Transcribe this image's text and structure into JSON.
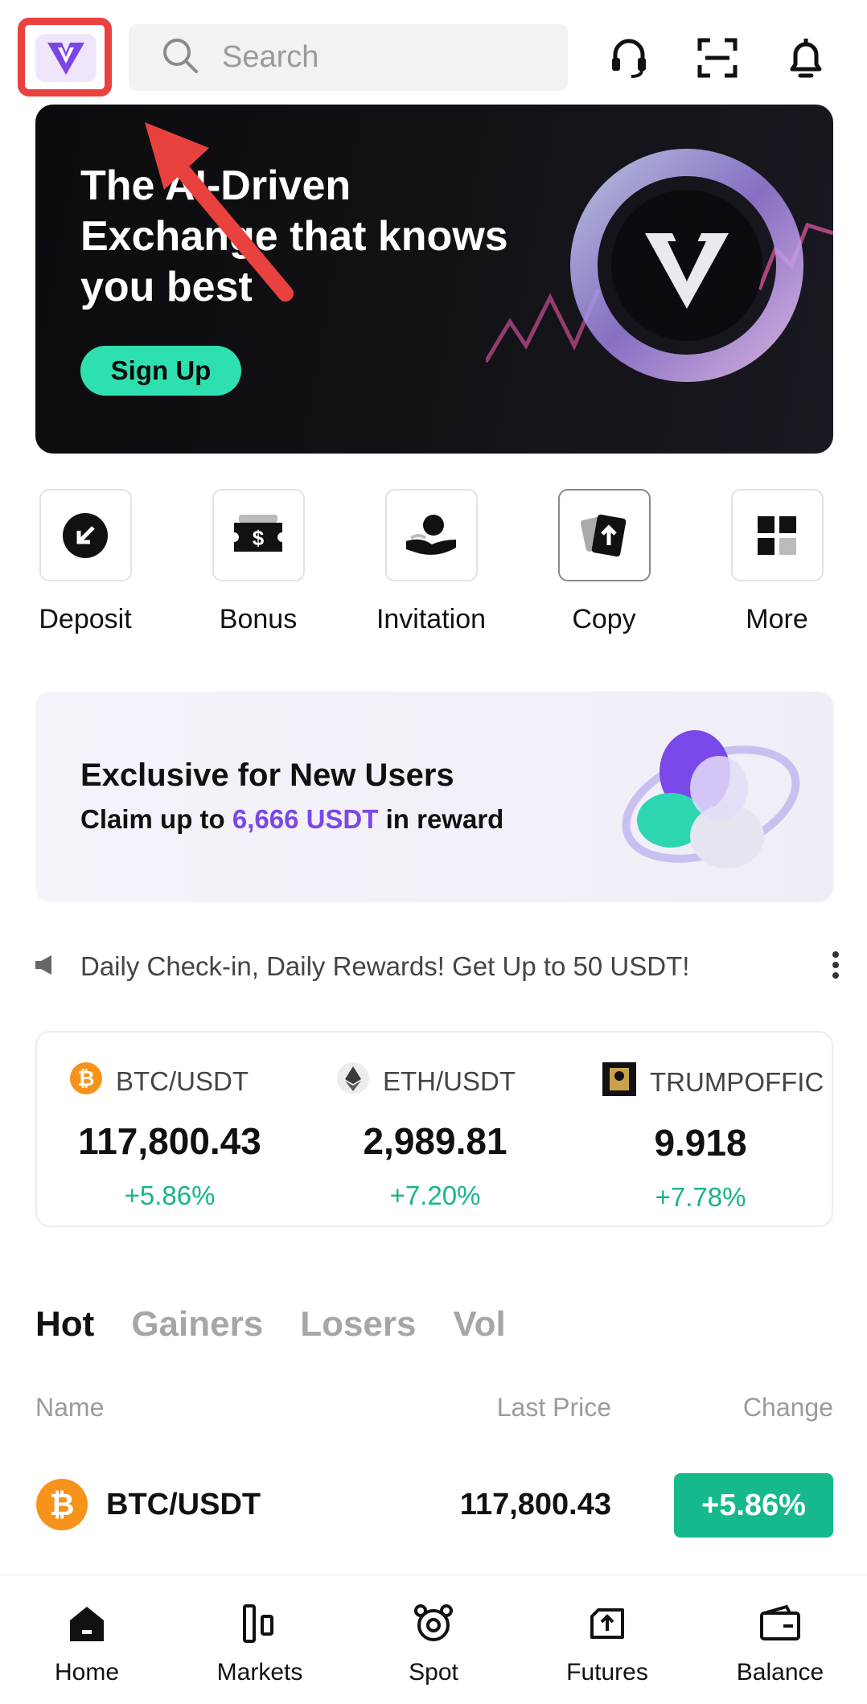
{
  "header": {
    "search_placeholder": "Search",
    "icons": [
      "support-headset-icon",
      "scan-icon",
      "bell-icon"
    ]
  },
  "banner": {
    "title_line1": "The AI-Driven",
    "title_line2": "Exchange that knows",
    "title_line3": "you best",
    "button_label": "Sign Up"
  },
  "actions": [
    {
      "label": "Deposit",
      "icon": "deposit-arrow-icon"
    },
    {
      "label": "Bonus",
      "icon": "ticket-dollar-icon"
    },
    {
      "label": "Invitation",
      "icon": "invitation-person-icon"
    },
    {
      "label": "Copy",
      "icon": "copy-card-icon"
    },
    {
      "label": "More",
      "icon": "grid-icon"
    }
  ],
  "promo": {
    "title": "Exclusive for New Users",
    "sub_prefix": "Claim up to ",
    "sub_amount": "6,666 USDT",
    "sub_suffix": " in reward"
  },
  "announcement": {
    "text": "Daily Check-in, Daily Rewards! Get Up to 50 USDT!"
  },
  "ticker": [
    {
      "pair": "BTC/USDT",
      "price": "117,800.43",
      "change": "+5.86%"
    },
    {
      "pair": "ETH/USDT",
      "price": "2,989.81",
      "change": "+7.20%"
    },
    {
      "pair": "TRUMPOFFIC",
      "price": "9.918",
      "change": "+7.78%"
    }
  ],
  "tabs": [
    "Hot",
    "Gainers",
    "Losers",
    "Vol"
  ],
  "table": {
    "col_name": "Name",
    "col_price": "Last Price",
    "col_change": "Change",
    "rows": [
      {
        "pair": "BTC/USDT",
        "price": "117,800.43",
        "change": "+5.86%"
      }
    ]
  },
  "bottom_nav": [
    "Home",
    "Markets",
    "Spot",
    "Futures",
    "Balance"
  ],
  "colors": {
    "accent_green": "#16b98c",
    "signup_green": "#2ee0b0",
    "promo_purple": "#7a48e8",
    "highlight_red": "#e8413e"
  }
}
